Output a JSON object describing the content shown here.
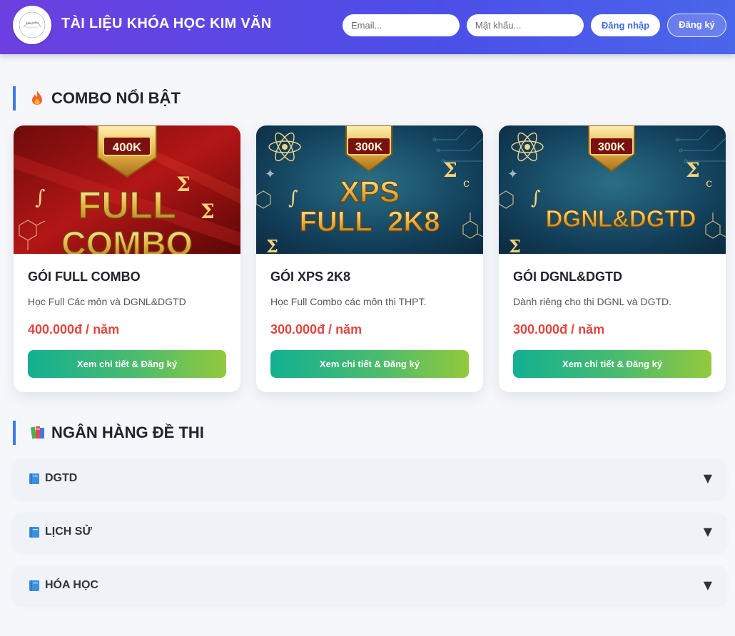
{
  "header": {
    "logo_text": "KIM VĂN",
    "site_title": "TÀI LIỆU KHÓA HỌC KIM VĂN",
    "email_placeholder": "Email...",
    "password_placeholder": "Mật khẩu...",
    "login_label": "Đăng nhập",
    "register_label": "Đăng ký"
  },
  "combo_section": {
    "title": "COMBO NỔI BẬT",
    "icon": "fire-icon",
    "cards": [
      {
        "badge": "400K",
        "banner_lines": [
          "FULL",
          "COMBO"
        ],
        "theme": "red",
        "name": "GÓI FULL COMBO",
        "description": "Học Full Các môn và DGNL&DGTD",
        "price": "400.000đ / năm",
        "button": "Xem chi tiết & Đăng ký"
      },
      {
        "badge": "300K",
        "banner_lines": [
          "XPS",
          "FULL  2K8"
        ],
        "theme": "blue",
        "name": "GÓI XPS 2K8",
        "description": "Học Full Combo các môn thi THPT.",
        "price": "300.000đ / năm",
        "button": "Xem chi tiết & Đăng ký"
      },
      {
        "badge": "300K",
        "banner_lines": [
          "DGNL&DGTD"
        ],
        "theme": "blue",
        "name": "GÓI DGNL&DGTD",
        "description": "Dành riêng cho thi DGNL và DGTD.",
        "price": "300.000đ / năm",
        "button": "Xem chi tiết & Đăng ký"
      }
    ]
  },
  "bank_section": {
    "title": "NGÂN HÀNG ĐỀ THI",
    "icon": "books-icon",
    "items": [
      {
        "label": "DGTD",
        "icon": "book-icon",
        "arrow": "▼"
      },
      {
        "label": "LỊCH SỬ",
        "icon": "book-icon",
        "arrow": "▼"
      },
      {
        "label": "HÓA HỌC",
        "icon": "book-icon",
        "arrow": "▼"
      }
    ]
  },
  "colors": {
    "header_start": "#6d3fe0",
    "header_end": "#4a66ea",
    "accent_blue": "#3f79e6",
    "price_red": "#e0473f",
    "button_start": "#12b092",
    "button_end": "#93c93d"
  }
}
